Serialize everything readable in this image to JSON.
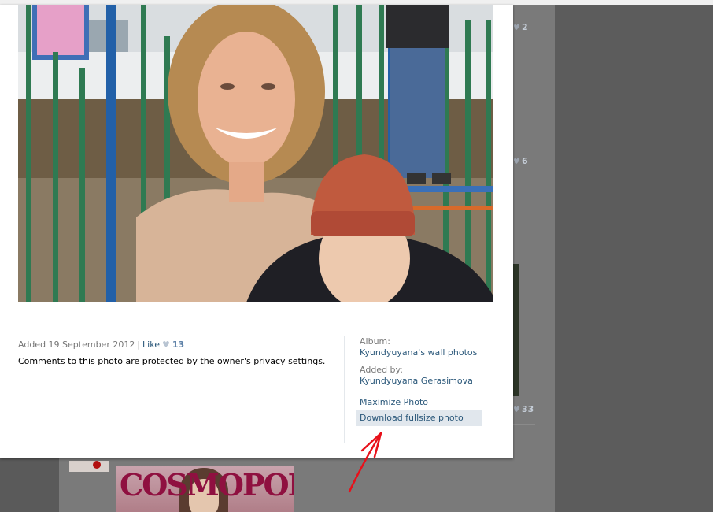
{
  "background_page": {
    "like_counts": [
      "2",
      "6",
      "33"
    ],
    "magazine_masthead": "COSMOPOLITAN"
  },
  "photo": {
    "alt": "photo"
  },
  "info": {
    "added_label": "Added 19 September 2012",
    "separator": "|",
    "like_label": "Like",
    "heart_icon": "heart-icon",
    "like_count": "13",
    "privacy_text": "Comments to this photo are protected by the owner's privacy settings."
  },
  "side": {
    "album_label": "Album:",
    "album_link": "Kyundyuyana's wall photos",
    "added_by_label": "Added by:",
    "added_by_link": "Kyundyuyana Gerasimova",
    "maximize_label": "Maximize Photo",
    "download_label": "Download fullsize photo"
  },
  "colors": {
    "link": "#2b587a",
    "muted": "#777777",
    "highlight": "#e1e7ed",
    "annotation": "#e8101a"
  }
}
